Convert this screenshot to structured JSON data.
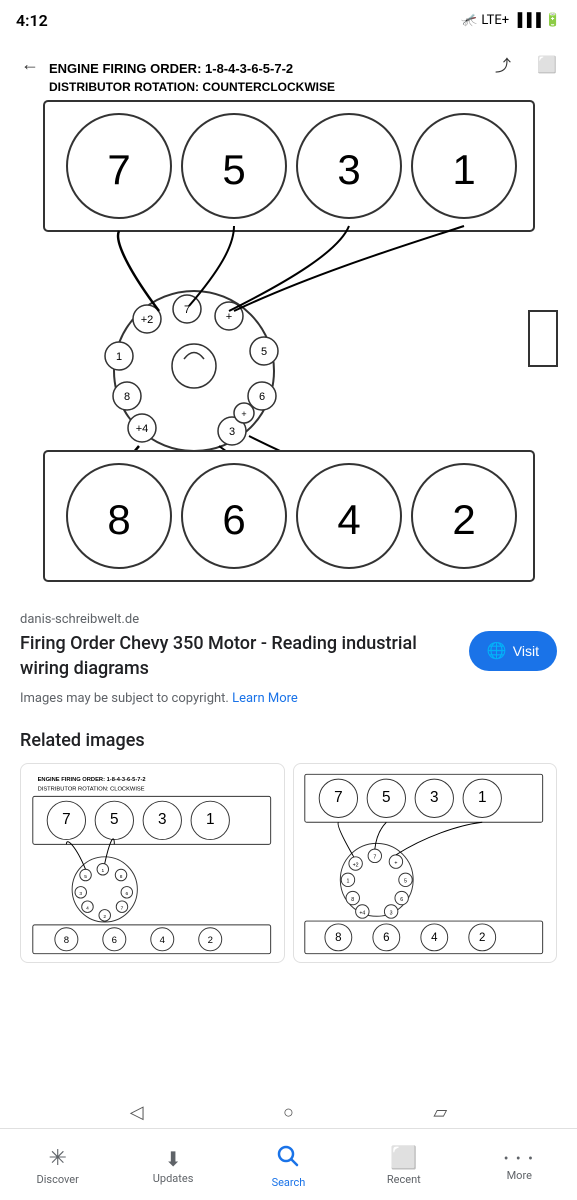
{
  "statusBar": {
    "time": "4:12",
    "lte": "LTE+",
    "notif_icon": "🦟"
  },
  "imageOverlay": {
    "backIcon": "←",
    "shareIcon": "⤴",
    "bookmarkIcon": "🔖"
  },
  "diagram": {
    "title": "Engine Firing Order Diagram",
    "firingOrderText": "ENGINE FIRING ORDER: 1-8-4-3-6-5-7-2",
    "distributorText": "DISTRIBUTOR ROTATION: COUNTERCLOCKWISE"
  },
  "source": {
    "domain": "danis-schreibwelt.de",
    "title": "Firing Order Chevy 350 Motor - Reading industrial wiring diagrams",
    "visitLabel": "Visit",
    "copyrightText": "Images may be subject to copyright.",
    "learnMoreLabel": "Learn More"
  },
  "relatedImages": {
    "sectionTitle": "Related images",
    "items": [
      {
        "alt": "Related firing order diagram 1"
      },
      {
        "alt": "Related firing order diagram 2"
      }
    ]
  },
  "bottomNav": {
    "items": [
      {
        "label": "Discover",
        "icon": "✳",
        "name": "discover"
      },
      {
        "label": "Updates",
        "icon": "⬇",
        "name": "updates"
      },
      {
        "label": "Search",
        "icon": "🔍",
        "name": "search",
        "active": true
      },
      {
        "label": "Recent",
        "icon": "⬜",
        "name": "recent"
      },
      {
        "label": "More",
        "icon": "•••",
        "name": "more"
      }
    ]
  },
  "gestureBar": {
    "back": "◁",
    "home": "○",
    "recent": "▱"
  }
}
